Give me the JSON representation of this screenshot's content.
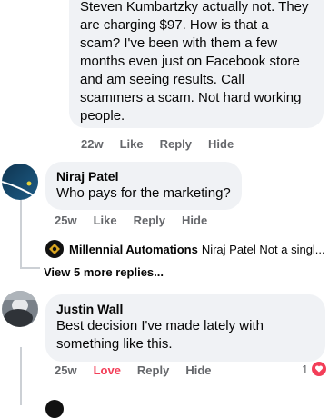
{
  "comment1": {
    "text": "Steven Kumbartzky actually not. They are charging $97. How is that a scam? I've been with them a few months even just on Facebook store and am seeing results. Call scammers a scam. Not hard working people.",
    "time": "22w",
    "like": "Like",
    "reply": "Reply",
    "hide": "Hide"
  },
  "comment2": {
    "author": "Niraj Patel",
    "text": "Who pays for the marketing?",
    "time": "25w",
    "like": "Like",
    "reply": "Reply",
    "hide": "Hide",
    "reply_preview": {
      "author": "Millennial Automations",
      "snippet": "Niraj Patel Not a singl..."
    },
    "view_more": "View 5 more replies..."
  },
  "comment3": {
    "author": "Justin Wall",
    "text": "Best decision I've made lately with something like this.",
    "time": "25w",
    "love": "Love",
    "reply": "Reply",
    "hide": "Hide",
    "reaction_count": "1"
  },
  "colors": {
    "bubble": "#f0f2f5",
    "meta": "#65676b",
    "love": "#f33e58"
  }
}
